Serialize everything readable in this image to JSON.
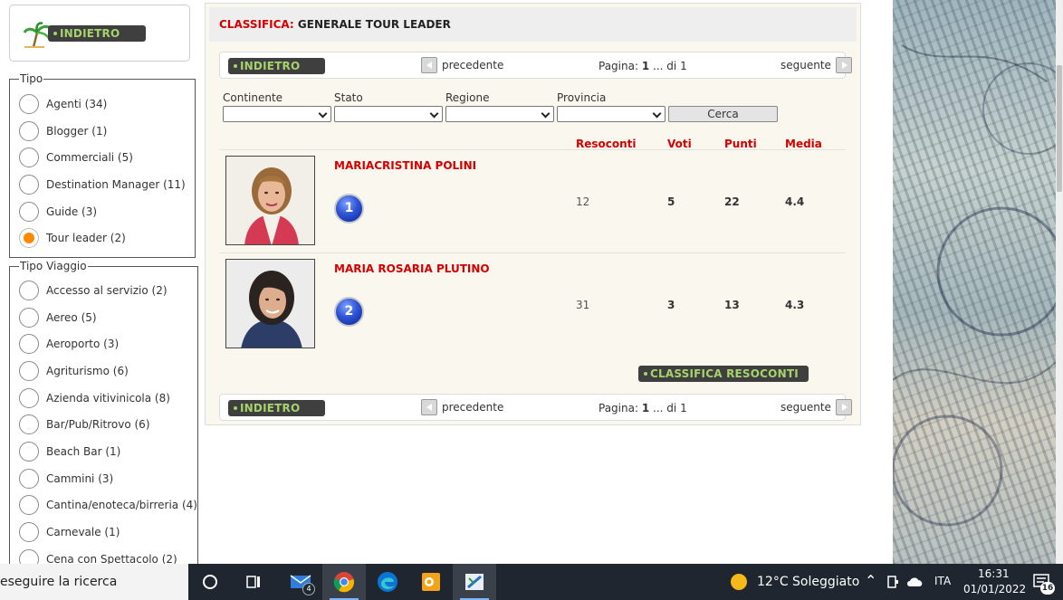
{
  "logo_box": {
    "back_label": "INDIETRO"
  },
  "tipo": {
    "legend": "Tipo",
    "items": [
      {
        "label": "Agenti (34)",
        "checked": false
      },
      {
        "label": "Blogger (1)",
        "checked": false
      },
      {
        "label": "Commerciali (5)",
        "checked": false
      },
      {
        "label": "Destination Manager (11)",
        "checked": false
      },
      {
        "label": "Guide (3)",
        "checked": false
      },
      {
        "label": "Tour leader (2)",
        "checked": true
      }
    ]
  },
  "tipo_viaggio": {
    "legend": "Tipo Viaggio",
    "items": [
      {
        "label": "Accesso al servizio (2)"
      },
      {
        "label": "Aereo (5)"
      },
      {
        "label": "Aeroporto (3)"
      },
      {
        "label": "Agriturismo (6)"
      },
      {
        "label": "Azienda vitivinicola (8)"
      },
      {
        "label": "Bar/Pub/Ritrovo (6)"
      },
      {
        "label": "Beach Bar (1)"
      },
      {
        "label": "Cammini (3)"
      },
      {
        "label": "Cantina/enoteca/birreria (4)"
      },
      {
        "label": "Carnevale (1)"
      },
      {
        "label": "Cena con Spettacolo (2)"
      }
    ]
  },
  "main": {
    "title_prefix": "CLASSIFICA:",
    "title": "GENERALE TOUR LEADER",
    "pager": {
      "back_label": "INDIETRO",
      "prev_label": "precedente",
      "next_label": "seguente",
      "page_label": "Pagina:",
      "page_current": "1",
      "page_sep": "... di",
      "page_total": "1"
    },
    "filters": {
      "continente": "Continente",
      "stato": "Stato",
      "regione": "Regione",
      "provincia": "Provincia",
      "search_button": "Cerca"
    },
    "columns": {
      "resoconti": "Resoconti",
      "voti": "Voti",
      "punti": "Punti",
      "media": "Media"
    },
    "rows": [
      {
        "rank": "1",
        "name": "MARIACRISTINA POLINI",
        "resoconti": "12",
        "voti": "5",
        "punti": "22",
        "media": "4.4"
      },
      {
        "rank": "2",
        "name": "MARIA ROSARIA PLUTINO",
        "resoconti": "31",
        "voti": "3",
        "punti": "13",
        "media": "4.3"
      }
    ],
    "classifica_button": "CLASSIFICA RESOCONTI"
  },
  "taskbar": {
    "search_text": "eseguire la ricerca",
    "mail_badge": "4",
    "weather": "12°C  Soleggiato",
    "language": "ITA",
    "time": "16:31",
    "date": "01/01/2022",
    "notif_count": "16"
  }
}
